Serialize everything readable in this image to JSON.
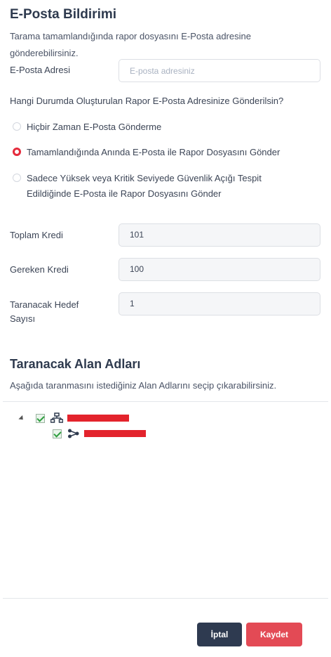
{
  "email_section": {
    "title": "E-Posta Bildirimi",
    "description": "Tarama tamamlandığında rapor dosyasını E-Posta adresine gönderebilirsiniz.",
    "address_label": "E-Posta Adresi",
    "address_value": "",
    "address_placeholder": "E-posta adresiniz",
    "question": "Hangi Durumda Oluşturulan Rapor E-Posta Adresinize Gönderilsin?",
    "options": [
      {
        "label": "Hiçbir Zaman E-Posta Gönderme",
        "selected": false
      },
      {
        "label": "Tamamlandığında Anında E-Posta ile Rapor Dosyasını Gönder",
        "selected": true
      },
      {
        "label": "Sadece Yüksek veya Kritik Seviyede Güvenlik Açığı Tespit Edildiğinde E-Posta ile Rapor Dosyasını Gönder",
        "selected": false
      }
    ]
  },
  "credits": {
    "total_label": "Toplam Kredi",
    "total_value": "101",
    "required_label": "Gereken Kredi",
    "required_value": "100",
    "targets_label": "Taranacak Hedef Sayısı",
    "targets_value": "1"
  },
  "domains_section": {
    "title": "Taranacak Alan Adları",
    "description": "Aşağıda taranmasını istediğiniz Alan Adlarını seçip çıkarabilirsiniz.",
    "tree": [
      {
        "icon": "network-icon",
        "checked": true,
        "redacted": true,
        "children": [
          {
            "icon": "share-node-icon",
            "checked": true,
            "redacted": true
          }
        ]
      }
    ]
  },
  "actions": {
    "cancel_label": "İptal",
    "save_label": "Kaydet"
  },
  "colors": {
    "accent_red": "#e52b3c",
    "save_button": "#e34a55",
    "cancel_button": "#2e3a50",
    "redaction": "#e3232c"
  }
}
